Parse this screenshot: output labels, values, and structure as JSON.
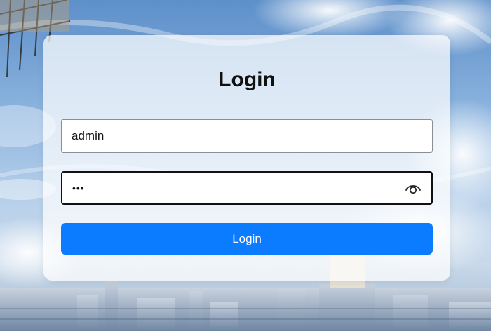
{
  "form": {
    "title": "Login",
    "username_value": "admin",
    "password_value": "•••",
    "submit_label": "Login"
  },
  "icons": {
    "password_toggle": "eye-icon"
  },
  "colors": {
    "accent": "#0b7bff"
  }
}
